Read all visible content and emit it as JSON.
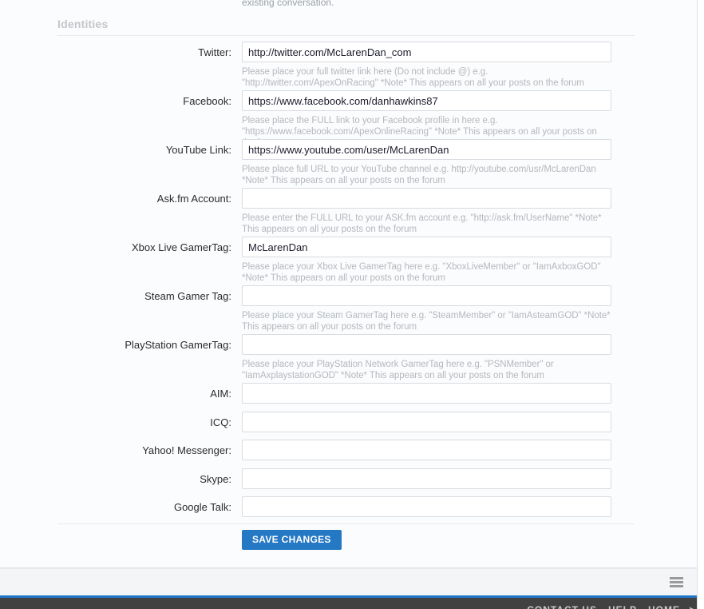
{
  "page": {
    "truncated_top_text": "existing conversation.",
    "section_title": "Identities"
  },
  "form": {
    "fields": [
      {
        "label": "Twitter:",
        "value": "http://twitter.com/McLarenDan_com",
        "placeholder": "",
        "name": "twitter",
        "help": "Please place your full twitter link here (Do not include @) e.g. \"http://twitter.com/ApexOnRacing\" *Note* This appears on all your posts on the forum"
      },
      {
        "label": "Facebook:",
        "value": "https://www.facebook.com/danhawkins87",
        "placeholder": "",
        "name": "facebook",
        "help": "Please place the FULL link to your Facebook profile in here e.g. \"https://www.facebook.com/ApexOnlineRacing\" *Note* This appears on all your posts on the forum"
      },
      {
        "label": "YouTube Link:",
        "value": "https://www.youtube.com/user/McLarenDan",
        "placeholder": "",
        "name": "youtube",
        "help": "Please place full URL to your YouTube channel e.g. http://youtube.com/usr/McLarenDan *Note* This appears on all your posts on the forum"
      },
      {
        "label": "Ask.fm Account:",
        "value": "",
        "placeholder": "",
        "name": "askfm",
        "help": "Please enter the FULL URL to your ASK.fm account e.g. \"http://ask.fm/UserName\" *Note* This appears on all your posts on the forum"
      },
      {
        "label": "Xbox Live GamerTag:",
        "value": "McLarenDan",
        "placeholder": "",
        "name": "xbox-live-gamertag",
        "help": "Please place your Xbox Live GamerTag here e.g. \"XboxLiveMember\" or \"IamAxboxGOD\" *Note* This appears on all your posts on the forum"
      },
      {
        "label": "Steam Gamer Tag:",
        "value": "",
        "placeholder": "",
        "name": "steam-gamer-tag",
        "help": "Please place your Steam GamerTag here e.g. \"SteamMember\" or \"IamAsteamGOD\" *Note* This appears on all your posts on the forum"
      },
      {
        "label": "PlayStation GamerTag:",
        "value": "",
        "placeholder": "",
        "name": "playstation-gamertag",
        "help": "Please place your PlayStation Network GamerTag here e.g. \"PSNMember\" or \"IamAxplaystationGOD\" *Note* This appears on all your posts on the forum"
      },
      {
        "label": "AIM:",
        "value": "",
        "placeholder": "",
        "name": "aim",
        "help": ""
      },
      {
        "label": "ICQ:",
        "value": "",
        "placeholder": "",
        "name": "icq",
        "help": ""
      },
      {
        "label": "Yahoo! Messenger:",
        "value": "",
        "placeholder": "",
        "name": "yahoo-messenger",
        "help": ""
      },
      {
        "label": "Skype:",
        "value": "",
        "placeholder": "",
        "name": "skype",
        "help": ""
      },
      {
        "label": "Google Talk:",
        "value": "",
        "placeholder": "",
        "name": "google-talk",
        "help": ""
      }
    ],
    "save_label": "SAVE CHANGES"
  },
  "footer": {
    "links": [
      "CONTACT US",
      "HELP",
      "HOME"
    ],
    "arrow_icon": "➤",
    "menu_icon": "hamburger-icon"
  },
  "colors": {
    "accent_blue": "#2578c4",
    "footer_dark": "#414141",
    "footer_accent": "#1f77c9",
    "page_background": "#fbfcfd",
    "help_text": "#b4b8bd"
  }
}
